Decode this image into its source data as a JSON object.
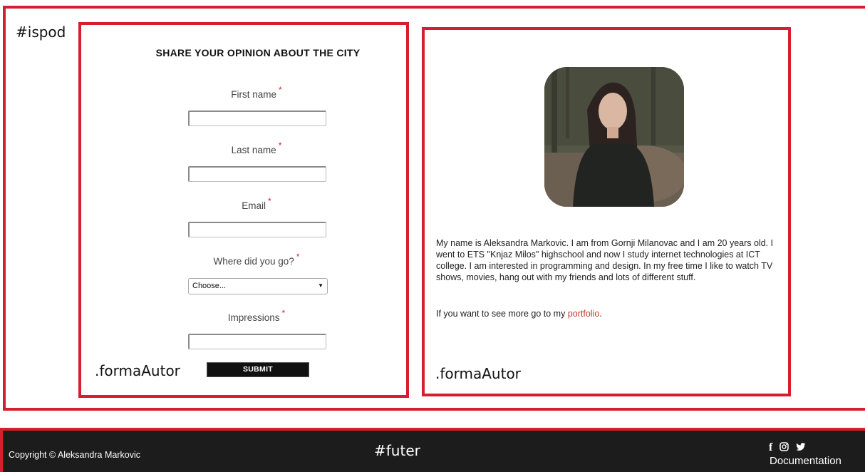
{
  "annotations": {
    "ispod": "#ispod",
    "forma_left": ".formaAutor",
    "forma_right": ".formaAutor",
    "futer": "#futer"
  },
  "form": {
    "title": "SHARE YOUR OPINION ABOUT THE CITY",
    "required_mark": "*",
    "fields": [
      {
        "label": "First name",
        "value": ""
      },
      {
        "label": "Last name",
        "value": ""
      },
      {
        "label": "Email",
        "value": ""
      },
      {
        "label": "Where did you go?",
        "selected": "Choose..."
      },
      {
        "label": "Impressions",
        "value": ""
      }
    ],
    "submit_label": "SUBMIT"
  },
  "author": {
    "bio": "My name is Aleksandra Markovic. I am from Gornji Milanovac and I am 20 years old. I went to ETS \"Knjaz Milos\" highschool and now I study internet technologies at ICT college. I am interested in programming and design. In my free time I like to watch TV shows, movies, hang out with my friends and lots of different stuff.",
    "more_text": "If you want to see more go to my ",
    "portfolio_link": "portfolio",
    "more_suffix": "."
  },
  "footer": {
    "copyright": "Copyright © Aleksandra Markovic",
    "social_icons": [
      "facebook-icon",
      "instagram-icon",
      "twitter-icon"
    ],
    "documentation": "Documentation"
  },
  "colors": {
    "accent_red": "#d4202c",
    "footer_bg": "#1c1c1c",
    "link": "#c0392b"
  }
}
